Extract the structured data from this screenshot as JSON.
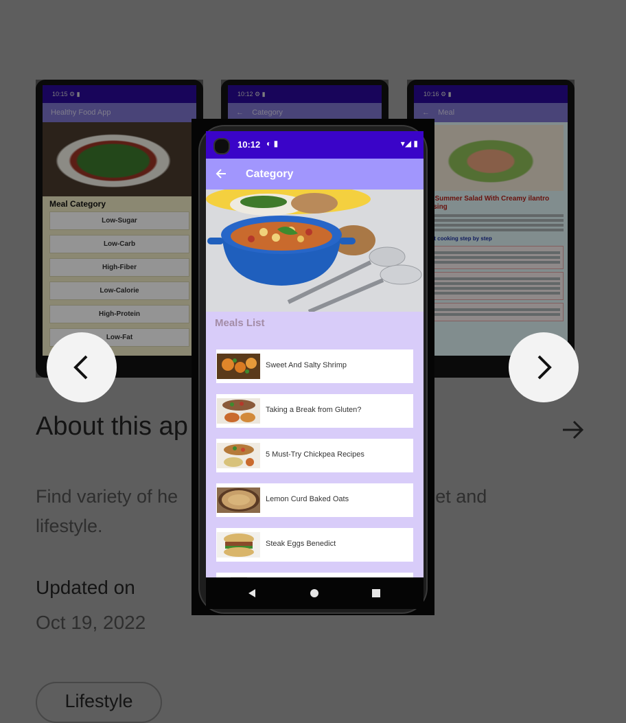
{
  "about": {
    "title": "About this ap",
    "description": "Find variety of he                                         our diet and lifestyle.",
    "updated_label": "Updated on",
    "updated_date": "Oct 19, 2022",
    "chip": "Lifestyle"
  },
  "carousel": {
    "prev_icon": "chevron-left-icon",
    "next_icon": "chevron-right-icon"
  },
  "screenshot1": {
    "time": "10:15",
    "app_title": "Healthy Food App",
    "category_header": "Meal Category",
    "categories": [
      "Low-Sugar",
      "Low-Carb",
      "High-Fiber",
      "Low-Calorie",
      "High-Protein",
      "Low-Fat"
    ]
  },
  "screenshot2": {
    "time": "10:12",
    "title": "Category"
  },
  "screenshot3": {
    "time": "10:16",
    "title": "Meal",
    "recipe_title": "rimp Summer Salad With Creamy ilantro Dressing",
    "steps_header": "'s start cooking step by step"
  },
  "main_phone": {
    "time": "10:12",
    "title": "Category",
    "section_title": "Meals List",
    "meals": [
      {
        "name": "Sweet And Salty Shrimp"
      },
      {
        "name": "Taking a Break from Gluten?"
      },
      {
        "name": "5 Must-Try Chickpea Recipes"
      },
      {
        "name": "Lemon Curd Baked Oats"
      },
      {
        "name": "Steak Eggs Benedict"
      },
      {
        "name": ""
      }
    ]
  },
  "colors": {
    "status_bar": "#3a04c8",
    "app_bar": "#a196fd",
    "list_bg": "#d8ccf9",
    "section_title": "#a38ca6"
  }
}
